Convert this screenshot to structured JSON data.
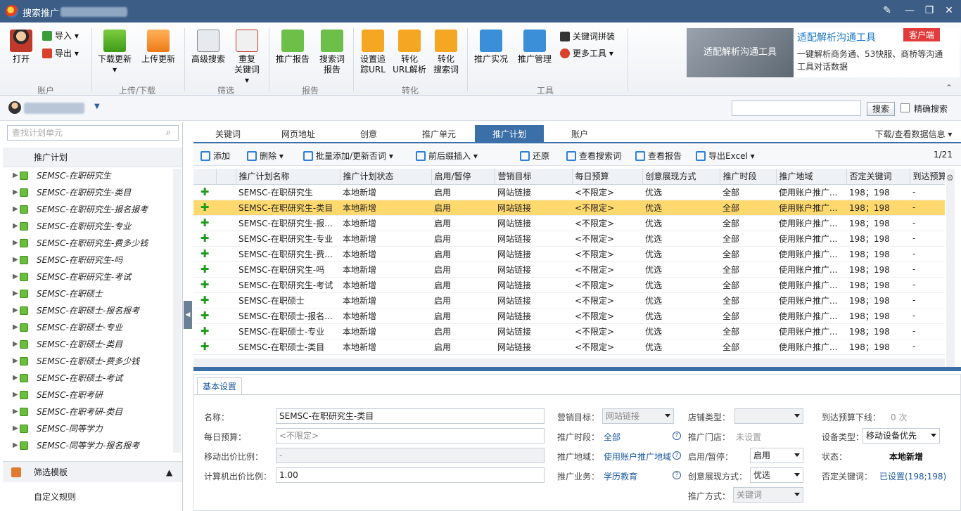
{
  "window": {
    "title": "搜索推广"
  },
  "ribbon": {
    "open": "打开",
    "import": "导入",
    "export": "导出",
    "download_update_1": "下载更新",
    "upload_update": "上传更新",
    "adv_search": "高级搜索",
    "dup_kw_1": "重复",
    "dup_kw_2": "关键词",
    "promo_report": "推广报告",
    "search_term_1": "搜索词",
    "search_term_2": "报告",
    "set_track_1": "设置追",
    "set_track_2": "踪URL",
    "conv_url_1": "转化",
    "conv_url_2": "URL解析",
    "conv_search_1": "转化",
    "conv_search_2": "搜索词",
    "promo_live": "推广实况",
    "promo_mgmt": "推广管理",
    "kw_combine": "关键词拼装",
    "more_tools": "更多工具",
    "groups": [
      "账户",
      "上传/下载",
      "筛选",
      "报告",
      "转化",
      "工具"
    ]
  },
  "ad": {
    "image_text": "适配解析沟通工具",
    "headline": "适配解析沟通工具",
    "desc": "一键解析商务通、53快服、商桥等沟通工具对话数据",
    "badge": "客户端"
  },
  "account_bar": {
    "search_button": "搜索",
    "exact_label": "精确搜索"
  },
  "sidebar": {
    "search_placeholder": "查找计划单元",
    "header": "推广计划",
    "items": [
      "SEMSC-在职研究生",
      "SEMSC-在职研究生-类目",
      "SEMSC-在职研究生-报名报考",
      "SEMSC-在职研究生-专业",
      "SEMSC-在职研究生-费多少钱",
      "SEMSC-在职研究生-吗",
      "SEMSC-在职研究生-考试",
      "SEMSC-在职硕士",
      "SEMSC-在职硕士-报名报考",
      "SEMSC-在职硕士-专业",
      "SEMSC-在职硕士-类目",
      "SEMSC-在职硕士-费多少钱",
      "SEMSC-在职硕士-考试",
      "SEMSC-在职考研",
      "SEMSC-在职考研-类目",
      "SEMSC-同等学力",
      "SEMSC-同等学力-报名报考"
    ],
    "filter_template": "筛选模板",
    "custom_rules": "自定义规则"
  },
  "tabs": [
    "关键词",
    "网页地址",
    "创意",
    "推广单元",
    "推广计划",
    "账户"
  ],
  "download_view": "下载/查看数据信息",
  "toolbar": {
    "add": "添加",
    "delete": "删除",
    "batch_add": "批量添加/更新否词",
    "insert": "前后缀插入",
    "restore": "还原",
    "view_search_terms": "查看搜索词",
    "view_report": "查看报告",
    "export_excel": "导出Excel",
    "page": "1/21"
  },
  "table": {
    "headers": [
      "推广计划名称",
      "推广计划状态",
      "启用/暂停",
      "营销目标",
      "每日预算",
      "创意展现方式",
      "推广时段",
      "推广地域",
      "否定关键词",
      "到达预算"
    ],
    "rows": [
      [
        "SEMSC-在职研究生",
        "本地新增",
        "启用",
        "网站链接",
        "<不限定>",
        "优选",
        "全部",
        "使用账户推广...",
        "198；198",
        "-"
      ],
      [
        "SEMSC-在职研究生-类目",
        "本地新增",
        "启用",
        "网站链接",
        "<不限定>",
        "优选",
        "全部",
        "使用账户推广...",
        "198；198",
        "-"
      ],
      [
        "SEMSC-在职研究生-报...",
        "本地新增",
        "启用",
        "网站链接",
        "<不限定>",
        "优选",
        "全部",
        "使用账户推广...",
        "198；198",
        "-"
      ],
      [
        "SEMSC-在职研究生-专业",
        "本地新增",
        "启用",
        "网站链接",
        "<不限定>",
        "优选",
        "全部",
        "使用账户推广...",
        "198；198",
        "-"
      ],
      [
        "SEMSC-在职研究生-费...",
        "本地新增",
        "启用",
        "网站链接",
        "<不限定>",
        "优选",
        "全部",
        "使用账户推广...",
        "198；198",
        "-"
      ],
      [
        "SEMSC-在职研究生-吗",
        "本地新增",
        "启用",
        "网站链接",
        "<不限定>",
        "优选",
        "全部",
        "使用账户推广...",
        "198；198",
        "-"
      ],
      [
        "SEMSC-在职研究生-考试",
        "本地新增",
        "启用",
        "网站链接",
        "<不限定>",
        "优选",
        "全部",
        "使用账户推广...",
        "198；198",
        "-"
      ],
      [
        "SEMSC-在职硕士",
        "本地新增",
        "启用",
        "网站链接",
        "<不限定>",
        "优选",
        "全部",
        "使用账户推广...",
        "198；198",
        "-"
      ],
      [
        "SEMSC-在职硕士-报名...",
        "本地新增",
        "启用",
        "网站链接",
        "<不限定>",
        "优选",
        "全部",
        "使用账户推广...",
        "198；198",
        "-"
      ],
      [
        "SEMSC-在职硕士-专业",
        "本地新增",
        "启用",
        "网站链接",
        "<不限定>",
        "优选",
        "全部",
        "使用账户推广...",
        "198；198",
        "-"
      ],
      [
        "SEMSC-在职硕士-类目",
        "本地新增",
        "启用",
        "网站链接",
        "<不限定>",
        "优选",
        "全部",
        "使用账户推广...",
        "198；198",
        "-"
      ]
    ]
  },
  "detail": {
    "tab": "基本设置",
    "name_label": "名称：",
    "name_value": "SEMSC-在职研究生-类目",
    "budget_label": "每日预算：",
    "budget_placeholder": "<不限定>",
    "mobile_label": "移动出价比例：",
    "mobile_value": "-",
    "pc_label": "计算机出价比例：",
    "pc_value": "1.00",
    "goal_label": "营销目标：",
    "goal_value": "网站链接",
    "time_label": "推广时段：",
    "time_value": "全部",
    "region_label": "推广地域：",
    "region_value": "使用账户推广地域",
    "biz_label": "推广业务：",
    "biz_value": "学历教育",
    "shop_type_label": "店铺类型：",
    "shop_label": "推广门店：",
    "shop_value": "未设置",
    "status_label": "启用/暂停：",
    "status_value": "启用",
    "creative_label": "创意展现方式：",
    "creative_value": "优选",
    "method_label": "推广方式：",
    "method_value": "关键词",
    "reach_label": "到达预算下线：",
    "reach_value": "0 次",
    "device_label": "设备类型：",
    "device_value": "移动设备优先",
    "state_label": "状态：",
    "state_value": "本地新增",
    "neg_label": "否定关键词：",
    "neg_value": "已设置(198;198)"
  }
}
